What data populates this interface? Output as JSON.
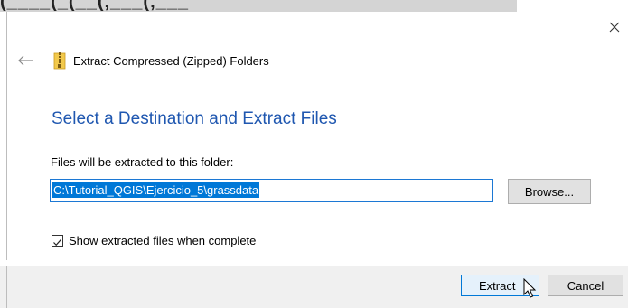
{
  "background_window": {
    "fragment_text": "(____(_(__(,___(,___"
  },
  "dialog": {
    "title": "Extract Compressed (Zipped) Folders",
    "heading": "Select a Destination and Extract Files",
    "destination_label": "Files will be extracted to this folder:",
    "destination_path": "C:\\Tutorial_QGIS\\Ejercicio_5\\grassdata",
    "browse_label": "Browse...",
    "show_files_label": "Show extracted files when complete",
    "show_files_checked": true,
    "extract_label": "Extract",
    "cancel_label": "Cancel",
    "close_symbol": "×",
    "icons": {
      "back": "back-arrow-icon",
      "folder": "zip-folder-icon",
      "close": "close-icon",
      "cursor": "mouse-pointer-icon"
    }
  },
  "colors": {
    "heading": "#1f57b0",
    "selection": "#0078d7",
    "footer": "#f0f0f0",
    "default_button_border": "#0078d7"
  }
}
